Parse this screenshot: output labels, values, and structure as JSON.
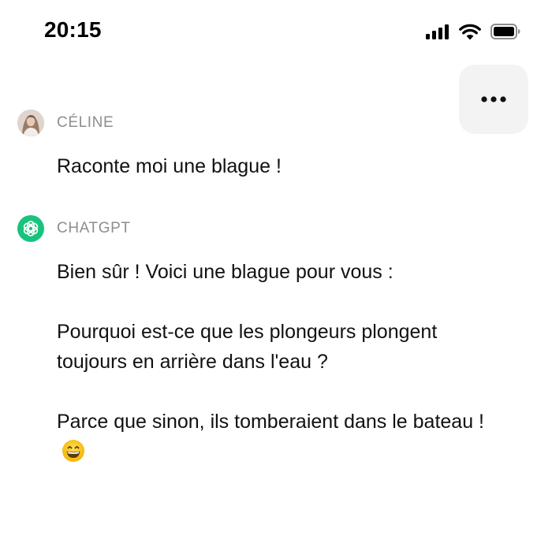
{
  "status_bar": {
    "time": "20:15",
    "icons": [
      "signal-icon",
      "wifi-icon",
      "battery-icon"
    ]
  },
  "toolbar": {
    "more_icon": "more-horizontal-icon"
  },
  "messages": [
    {
      "author": "CÉLINE",
      "avatar_icon": "user-avatar",
      "paragraphs": [
        "Raconte moi une blague !"
      ]
    },
    {
      "author": "CHATGPT",
      "avatar_icon": "chatgpt-logo-icon",
      "paragraphs": [
        "Bien sûr ! Voici une blague pour vous :",
        "Pourquoi est-ce que les plongeurs plongent toujours en arrière dans l'eau ?",
        "Parce que sinon, ils tomberaient dans le bateau !"
      ],
      "trailing_emoji_icon": "grinning-face-emoji-icon"
    }
  ],
  "colors": {
    "bot_accent": "#19c37d",
    "author_label": "#8e8e8e",
    "more_button_bg": "#f3f3f3"
  }
}
